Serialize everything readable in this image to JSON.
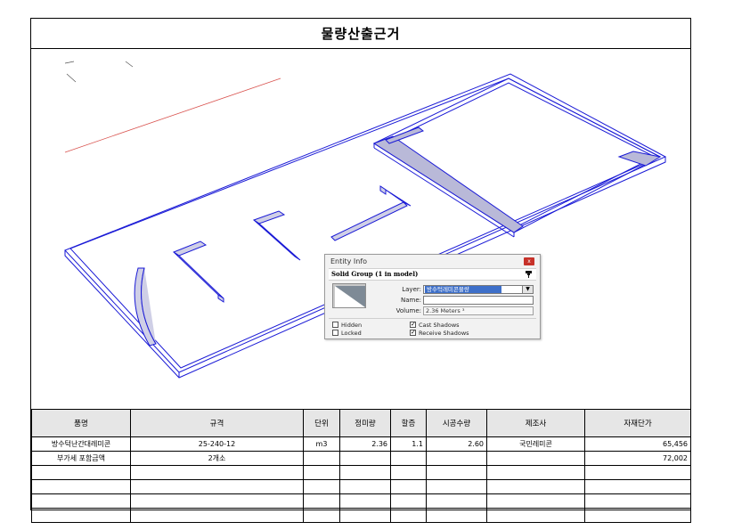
{
  "title": "물량산출근거",
  "entity_info": {
    "window_title": "Entity Info",
    "close_label": "x",
    "header": "Solid Group (1 in model)",
    "layer_label": "Layer:",
    "layer_value": "방수턱레미콘물량",
    "name_label": "Name:",
    "name_value": "",
    "volume_label": "Volume:",
    "volume_value": "2.36 Meters ³",
    "hidden_label": "Hidden",
    "locked_label": "Locked",
    "cast_shadows_label": "Cast Shadows",
    "receive_shadows_label": "Receive Shadows",
    "hidden_checked": false,
    "locked_checked": false,
    "cast_shadows_checked": true,
    "receive_shadows_checked": true
  },
  "table": {
    "headers": [
      "품명",
      "규격",
      "단위",
      "정미량",
      "할증",
      "시공수량",
      "제조사",
      "자재단가"
    ],
    "rows": [
      [
        "방수턱난간대레미콘",
        "25-240-12",
        "m3",
        "2.36",
        "1.1",
        "2.60",
        "국민레미콘",
        "65,456"
      ],
      [
        "부가세 포함금액",
        "2개소",
        "",
        "",
        "",
        "",
        "",
        "72,002"
      ],
      [
        "",
        "",
        "",
        "",
        "",
        "",
        "",
        ""
      ],
      [
        "",
        "",
        "",
        "",
        "",
        "",
        "",
        ""
      ],
      [
        "",
        "",
        "",
        "",
        "",
        "",
        "",
        ""
      ],
      [
        "",
        "",
        "",
        "",
        "",
        "",
        "",
        ""
      ]
    ]
  },
  "colors": {
    "edge": "#1a1ad6",
    "axis": "#d9534f",
    "header_bg": "#e6e6e6",
    "layer_highlight": "#3d6fc9"
  }
}
